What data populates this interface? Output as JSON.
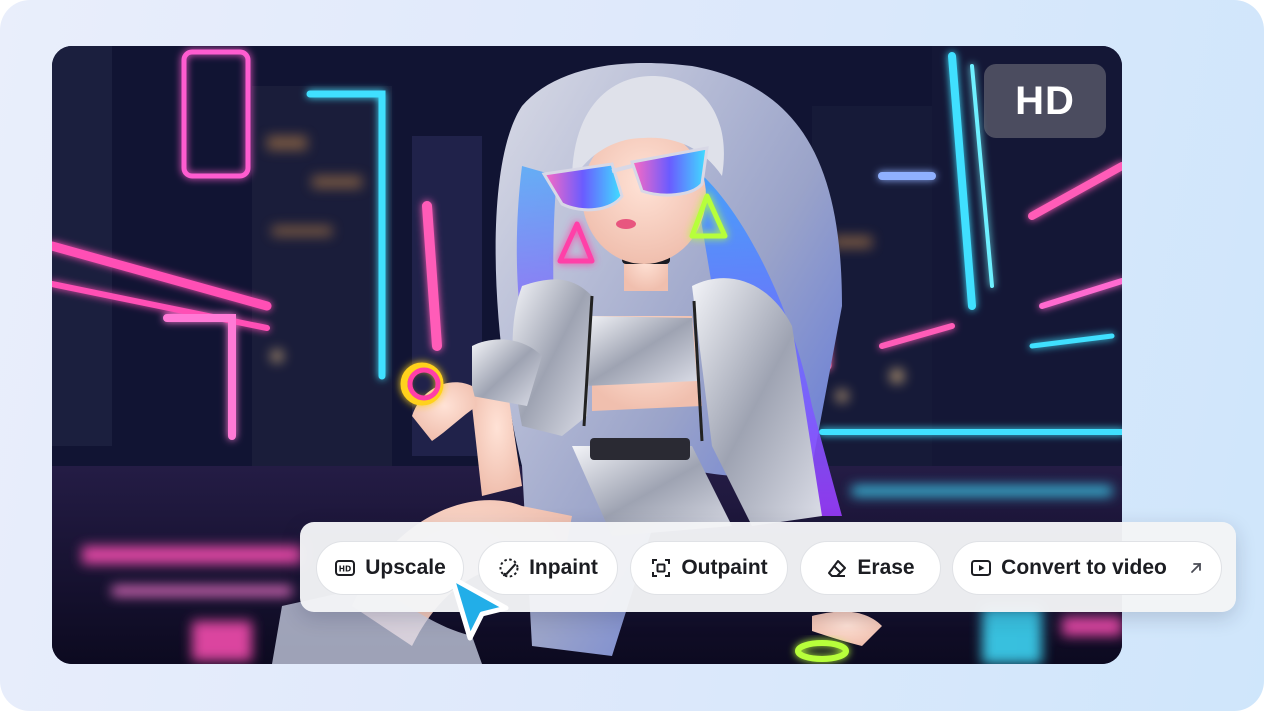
{
  "badge": {
    "label": "HD"
  },
  "toolbar": {
    "buttons": [
      {
        "id": "upscale",
        "label": "Upscale",
        "icon": "hd-box-icon"
      },
      {
        "id": "inpaint",
        "label": "Inpaint",
        "icon": "brush-icon"
      },
      {
        "id": "outpaint",
        "label": "Outpaint",
        "icon": "expand-frame-icon"
      },
      {
        "id": "erase",
        "label": "Erase",
        "icon": "eraser-icon"
      },
      {
        "id": "convert",
        "label": "Convert to video",
        "icon": "play-box-icon",
        "trailing_icon": "external-arrow-icon"
      }
    ]
  },
  "image": {
    "subject": "doll in silver jacket on neon-lit city street at night"
  },
  "colors": {
    "accent_cursor": "#22aee8",
    "neon_pink": "#ff3fa8",
    "neon_cyan": "#3fe0ff",
    "neon_purple": "#a35cff"
  }
}
